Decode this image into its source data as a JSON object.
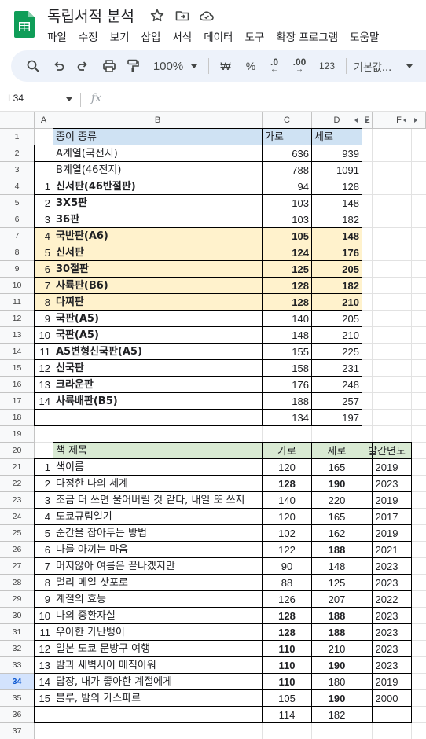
{
  "app": {
    "doc_title": "독립서적 분석",
    "menu": [
      "파일",
      "수정",
      "보기",
      "삽입",
      "서식",
      "데이터",
      "도구",
      "확장 프로그램",
      "도움말"
    ]
  },
  "toolbar": {
    "zoom": "100%",
    "currency": "₩",
    "percent": "%",
    "decimal_decrease": ".0",
    "decimal_increase": ".00",
    "number_format": "123",
    "font": "기본값..."
  },
  "formula_bar": {
    "cell_ref": "L34",
    "fx": "fx",
    "value": ""
  },
  "columns": [
    "A",
    "B",
    "C",
    "D",
    "E",
    "F"
  ],
  "selected_row": 34,
  "colors": {
    "header_blue": "#cfe2f3",
    "highlight_yellow": "#fff2cc",
    "header_green": "#d9ead3",
    "selection": "#d3e3fd"
  },
  "row_numbers": [
    "1",
    "2",
    "3",
    "4",
    "5",
    "6",
    "7",
    "8",
    "9",
    "10",
    "11",
    "12",
    "13",
    "14",
    "15",
    "16",
    "17",
    "18",
    "19",
    "20",
    "21",
    "22",
    "23",
    "24",
    "25",
    "26",
    "27",
    "28",
    "29",
    "30",
    "31",
    "32",
    "33",
    "34",
    "35",
    "36",
    "37"
  ],
  "paper_table": {
    "header": {
      "name": "종이 종류",
      "w": "가로",
      "h": "세로"
    },
    "rows": [
      {
        "n": "",
        "name": "A계열(국전지)",
        "w": "636",
        "h": "939",
        "bold": false,
        "hl": false
      },
      {
        "n": "",
        "name": "B계열(46전지)",
        "w": "788",
        "h": "1091",
        "bold": false,
        "hl": false
      },
      {
        "n": "1",
        "name": "신서판(46반절판)",
        "w": "94",
        "h": "128",
        "bold": true,
        "hl": false
      },
      {
        "n": "2",
        "name": "3X5판",
        "w": "103",
        "h": "148",
        "bold": true,
        "hl": false
      },
      {
        "n": "3",
        "name": "36판",
        "w": "103",
        "h": "182",
        "bold": true,
        "hl": false
      },
      {
        "n": "4",
        "name": "국반판(A6)",
        "w": "105",
        "h": "148",
        "bold": true,
        "hl": true
      },
      {
        "n": "5",
        "name": "신서판",
        "w": "124",
        "h": "176",
        "bold": true,
        "hl": true
      },
      {
        "n": "6",
        "name": "30절판",
        "w": "125",
        "h": "205",
        "bold": true,
        "hl": true
      },
      {
        "n": "7",
        "name": "사륙판(B6)",
        "w": "128",
        "h": "182",
        "bold": true,
        "hl": true
      },
      {
        "n": "8",
        "name": "다찌판",
        "w": "128",
        "h": "210",
        "bold": true,
        "hl": true
      },
      {
        "n": "9",
        "name": "국판(A5)",
        "w": "140",
        "h": "205",
        "bold": true,
        "hl": false
      },
      {
        "n": "10",
        "name": "국판(A5)",
        "w": "148",
        "h": "210",
        "bold": true,
        "hl": false
      },
      {
        "n": "11",
        "name": "A5변형신국판(A5)",
        "w": "155",
        "h": "225",
        "bold": true,
        "hl": false
      },
      {
        "n": "12",
        "name": "신국판",
        "w": "158",
        "h": "231",
        "bold": true,
        "hl": false
      },
      {
        "n": "13",
        "name": "크라운판",
        "w": "176",
        "h": "248",
        "bold": true,
        "hl": false
      },
      {
        "n": "14",
        "name": "사륙배판(B5)",
        "w": "188",
        "h": "257",
        "bold": true,
        "hl": false
      },
      {
        "n": "",
        "name": "",
        "w": "134",
        "h": "197",
        "bold": false,
        "hl": false
      }
    ]
  },
  "book_table": {
    "header": {
      "name": "책 제목",
      "w": "가로",
      "h": "세로",
      "year": "발간년도"
    },
    "rows": [
      {
        "n": "1",
        "name": "색이름",
        "w": "120",
        "h": "165",
        "y": "2019",
        "bw": false,
        "bh": false
      },
      {
        "n": "2",
        "name": "다정한 나의 세계",
        "w": "128",
        "h": "190",
        "y": "2023",
        "bw": true,
        "bh": true
      },
      {
        "n": "3",
        "name": "조금 더 쓰면 울어버릴 것 같다, 내일 또 쓰지",
        "w": "140",
        "h": "220",
        "y": "2019",
        "bw": false,
        "bh": false
      },
      {
        "n": "4",
        "name": "도쿄규림일기",
        "w": "120",
        "h": "165",
        "y": "2017",
        "bw": false,
        "bh": false
      },
      {
        "n": "5",
        "name": "순간을 잡아두는 방법",
        "w": "102",
        "h": "162",
        "y": "2019",
        "bw": false,
        "bh": false
      },
      {
        "n": "6",
        "name": "나를 아끼는 마음",
        "w": "122",
        "h": "188",
        "y": "2021",
        "bw": false,
        "bh": true
      },
      {
        "n": "7",
        "name": "머지않아 여름은 끝나겠지만",
        "w": "90",
        "h": "148",
        "y": "2023",
        "bw": false,
        "bh": false
      },
      {
        "n": "8",
        "name": "멀리 메일 삿포로",
        "w": "88",
        "h": "125",
        "y": "2023",
        "bw": false,
        "bh": false
      },
      {
        "n": "9",
        "name": "계절의 효능",
        "w": "126",
        "h": "207",
        "y": "2022",
        "bw": false,
        "bh": false
      },
      {
        "n": "10",
        "name": "나의 중환자실",
        "w": "128",
        "h": "188",
        "y": "2023",
        "bw": true,
        "bh": true
      },
      {
        "n": "11",
        "name": "우아한 가난뱅이",
        "w": "128",
        "h": "188",
        "y": "2023",
        "bw": true,
        "bh": true
      },
      {
        "n": "12",
        "name": "일본 도쿄 문방구 여행",
        "w": "110",
        "h": "210",
        "y": "2023",
        "bw": true,
        "bh": false
      },
      {
        "n": "13",
        "name": "밤과 새벽사이 매직아워",
        "w": "110",
        "h": "190",
        "y": "2023",
        "bw": true,
        "bh": true
      },
      {
        "n": "14",
        "name": "답장, 내가 좋아한 계절에게",
        "w": "110",
        "h": "180",
        "y": "2019",
        "bw": true,
        "bh": false
      },
      {
        "n": "15",
        "name": "블루, 밤의 가스파르",
        "w": "105",
        "h": "190",
        "y": "2000",
        "bw": false,
        "bh": true
      },
      {
        "n": "",
        "name": "",
        "w": "114",
        "h": "182",
        "y": "",
        "bw": false,
        "bh": false
      }
    ]
  }
}
